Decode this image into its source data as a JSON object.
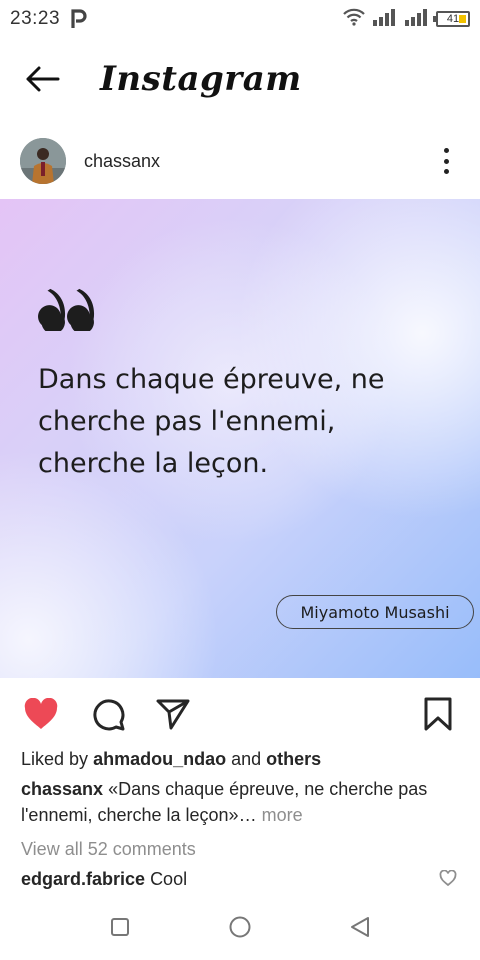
{
  "status_bar": {
    "time": "23:23",
    "app_badge_icon": "p-icon",
    "battery_level": "41",
    "icons": [
      "wifi-icon",
      "signal-icon",
      "signal-icon",
      "battery-icon"
    ]
  },
  "header": {
    "back_icon": "arrow-left-icon",
    "brand": "Instagram"
  },
  "post": {
    "username": "chassanx",
    "avatar_icon": "avatar",
    "more_icon": "more-vertical-icon",
    "image": {
      "quote_icon": "quote-icon",
      "quote_text": "Dans chaque épreuve, ne cherche pas l'ennemi, cherche la leçon.",
      "author": "Miyamoto Musashi"
    },
    "actions": {
      "like_icon": "heart-filled-icon",
      "comment_icon": "comment-icon",
      "share_icon": "send-icon",
      "save_icon": "bookmark-icon",
      "like_color": "#ed4956"
    },
    "likes": {
      "prefix": "Liked by",
      "user": "ahmadou_ndao",
      "middle": "and",
      "others": "others"
    },
    "caption": {
      "user": "chassanx",
      "text": "«Dans chaque épreuve, ne cherche pas l'ennemi, cherche la leçon»",
      "ellipsis": "…",
      "more": "more"
    },
    "view_comments": "View all 52 comments",
    "comment": {
      "user": "edgard.fabrice",
      "text": "Cool"
    }
  },
  "nav_bar": {
    "recents_icon": "square-icon",
    "home_icon": "circle-icon",
    "back_icon": "triangle-back-icon"
  }
}
